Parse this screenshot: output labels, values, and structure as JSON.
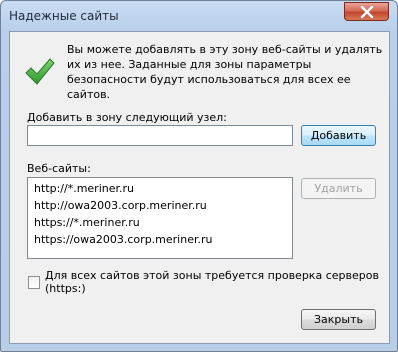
{
  "window": {
    "title": "Надежные сайты"
  },
  "icons": {
    "status": "checkmark-icon",
    "close": "close-icon"
  },
  "description": "Вы можете добавлять в эту зону  веб-сайты и удалять их из нее. Заданные для зоны параметры безопасности будут использоваться для всех ее сайтов.",
  "add_section": {
    "label": "Добавить в зону следующий узел:",
    "input_value": "",
    "button_label": "Добавить"
  },
  "sites_section": {
    "label": "Веб-сайты:",
    "items": [
      "http://*.meriner.ru",
      "http://owa2003.corp.meriner.ru",
      "https://*.meriner.ru",
      "https://owa2003.corp.meriner.ru"
    ],
    "remove_label": "Удалить"
  },
  "verify": {
    "label": "Для всех сайтов этой зоны требуется проверка серверов (https:)",
    "checked": false
  },
  "footer": {
    "close_label": "Закрыть"
  },
  "colors": {
    "frame": "#b9cfea",
    "client_bg": "#f0f0f0",
    "check_green": "#3aa83a",
    "close_red": "#c24530"
  }
}
